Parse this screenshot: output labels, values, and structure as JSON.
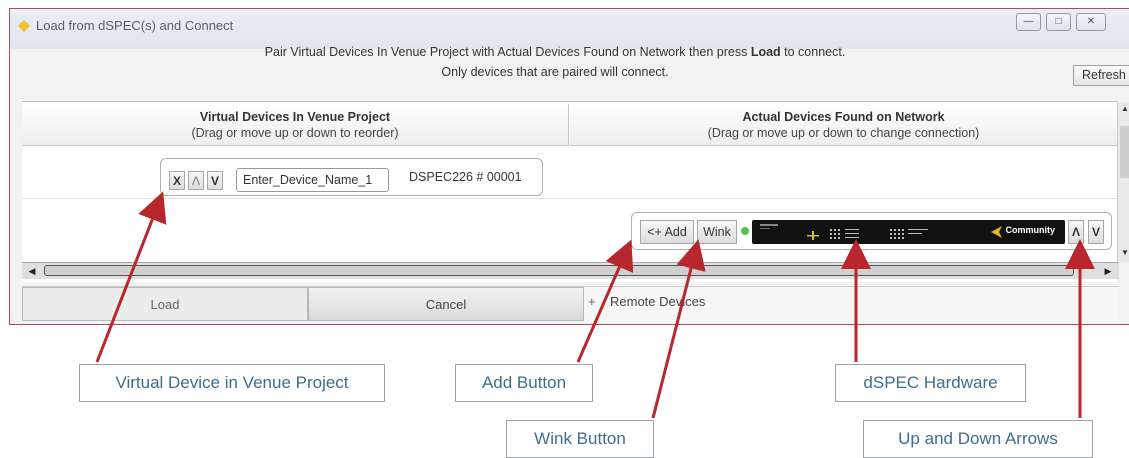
{
  "window": {
    "title": "Load from dSPEC(s) and Connect",
    "controls": {
      "minimize": "—",
      "maximize": "□",
      "close": "✕"
    }
  },
  "instructions": {
    "line1_pre": "Pair Virtual Devices In Venue Project with Actual Devices Found on Network then press ",
    "line1_bold": "Load",
    "line1_post": " to connect.",
    "line2": "Only devices that are paired will connect."
  },
  "refresh_label": "Refresh",
  "columns": {
    "virtual": {
      "title": "Virtual Devices In Venue Project",
      "subtitle": "(Drag or move up or down to reorder)"
    },
    "actual": {
      "title": "Actual Devices Found on Network",
      "subtitle": "(Drag or move up or down to change connection)"
    }
  },
  "virtual_device": {
    "remove_label": "X",
    "up_label": "Λ",
    "down_label": "V",
    "name": "Enter_Device_Name_1",
    "serial": "DSPEC226 # 00001"
  },
  "actual_device": {
    "add_label": "<+ Add",
    "wink_label": "Wink",
    "brand": "Community",
    "up_label": "Λ",
    "down_label": "V",
    "led_color": "#54c24e"
  },
  "buttons": {
    "load": "Load",
    "cancel": "Cancel"
  },
  "remote_devices_label": "Remote Devices",
  "callouts": {
    "virtual_device": "Virtual Device in Venue Project",
    "add_button": "Add Button",
    "dspec_hardware": "dSPEC Hardware",
    "wink_button": "Wink Button",
    "up_down_arrows": "Up and Down Arrows"
  },
  "colors": {
    "arrow": "#b8272c",
    "window_border": "#b5465f",
    "callout_text": "#3f6d8c"
  }
}
